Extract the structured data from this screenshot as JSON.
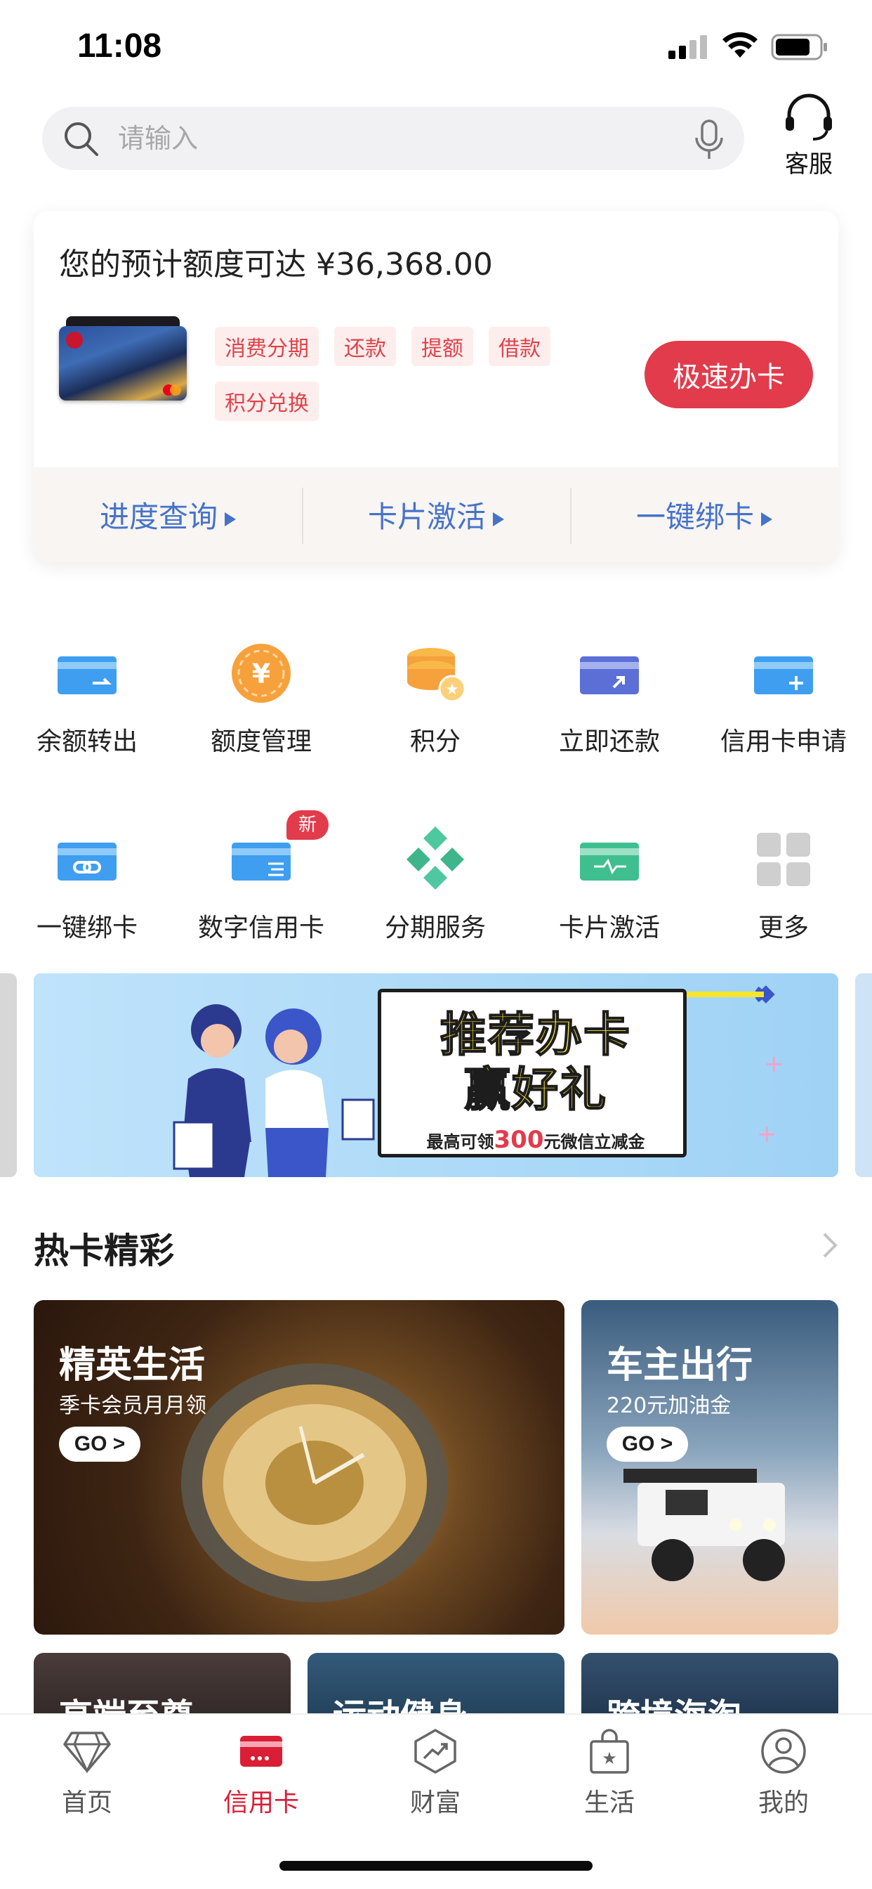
{
  "status_bar": {
    "time": "11:08"
  },
  "search": {
    "placeholder": "请输入"
  },
  "customer_service": {
    "label": "客服"
  },
  "card_panel": {
    "limit_text": "您的预计额度可达 ¥36,368.00",
    "tags": [
      "消费分期",
      "还款",
      "提额",
      "借款",
      "积分兑换"
    ],
    "apply_button": "极速办卡",
    "links": [
      "进度查询",
      "卡片激活",
      "一键绑卡"
    ]
  },
  "grid": {
    "items": [
      {
        "label": "余额转出",
        "icon": "card-transfer-icon"
      },
      {
        "label": "额度管理",
        "icon": "yuan-coin-icon"
      },
      {
        "label": "积分",
        "icon": "points-coins-icon"
      },
      {
        "label": "立即还款",
        "icon": "card-repay-icon"
      },
      {
        "label": "信用卡申请",
        "icon": "card-apply-icon"
      },
      {
        "label": "一键绑卡",
        "icon": "card-link-icon"
      },
      {
        "label": "数字信用卡",
        "icon": "digital-card-icon",
        "badge": "新"
      },
      {
        "label": "分期服务",
        "icon": "installment-diamond-icon"
      },
      {
        "label": "卡片激活",
        "icon": "card-activate-icon"
      },
      {
        "label": "更多",
        "icon": "more-grid-icon"
      }
    ]
  },
  "banner": {
    "title_line1": "推荐办卡",
    "title_line2": "赢好礼",
    "subtitle_pre": "最高可领",
    "subtitle_amount": "300",
    "subtitle_post": "元微信立减金"
  },
  "hot_cards": {
    "section_title": "热卡精彩",
    "items": [
      {
        "title": "精英生活",
        "subtitle": "季卡会员月月领",
        "go": "GO >"
      },
      {
        "title": "车主出行",
        "subtitle": "220元加油金",
        "go": "GO >"
      },
      {
        "title": "高端至尊"
      },
      {
        "title": "运动健身"
      },
      {
        "title": "跨境海淘"
      }
    ]
  },
  "tabbar": {
    "tabs": [
      {
        "label": "首页",
        "icon": "diamond-icon"
      },
      {
        "label": "信用卡",
        "icon": "credit-card-icon",
        "active": true
      },
      {
        "label": "财富",
        "icon": "wealth-chart-icon"
      },
      {
        "label": "生活",
        "icon": "shopping-bag-icon"
      },
      {
        "label": "我的",
        "icon": "user-profile-icon"
      }
    ]
  },
  "colors": {
    "accent": "#e23b4b",
    "link_blue": "#4673c9",
    "tab_active": "#d91e36"
  }
}
